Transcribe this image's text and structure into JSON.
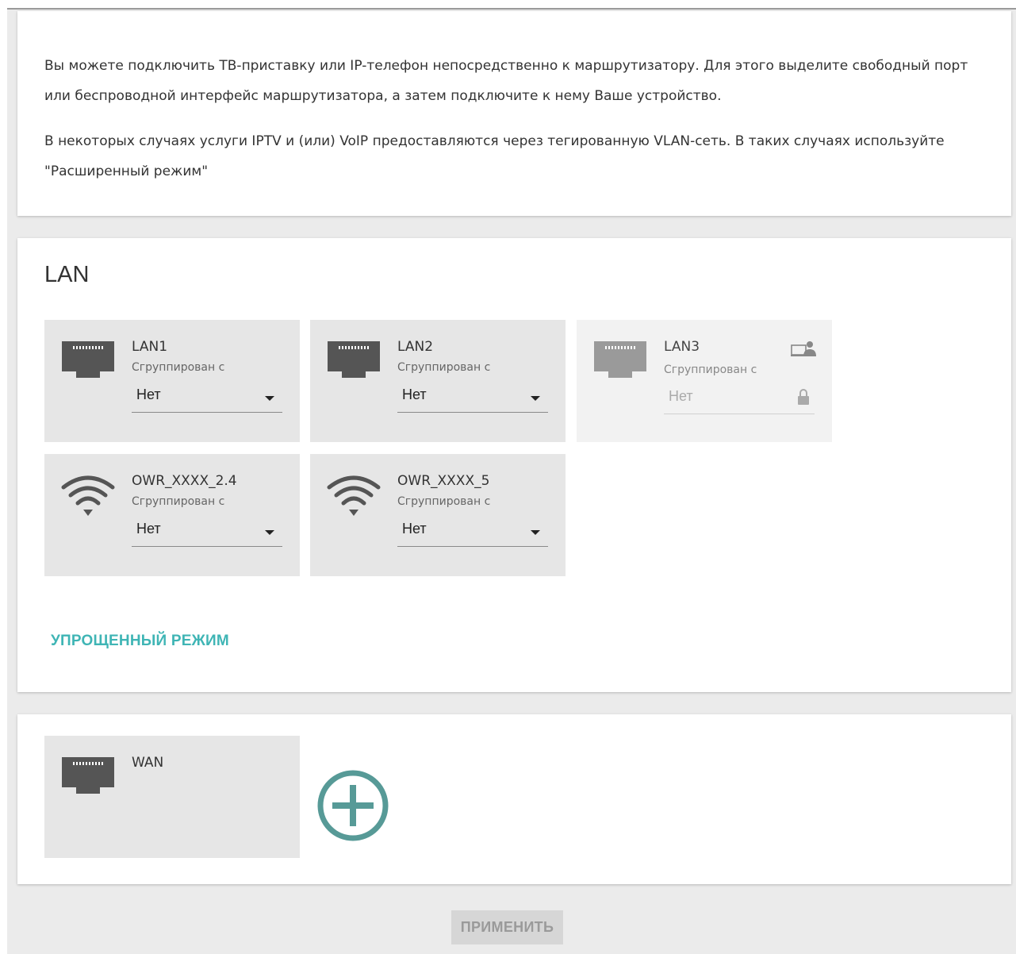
{
  "info": {
    "paragraph1": "Вы можете подключить ТВ-приставку или IP-телефон непосредственно к маршрутизатору. Для этого выделите свободный порт или беспроводной интерфейс маршрутизатора, а затем подключите к нему Ваше устройство.",
    "paragraph2": "В некоторых случаях услуги IPTV и (или) VoIP предоставляются через тегированную VLAN-сеть. В таких случаях используйте \"Расширенный режим\""
  },
  "lan": {
    "title": "LAN",
    "ports": [
      {
        "name": "LAN1",
        "grouped_label": "Сгруппирован с",
        "value": "Нет",
        "icon": "ethernet-port-icon",
        "disabled": false
      },
      {
        "name": "LAN2",
        "grouped_label": "Сгруппирован с",
        "value": "Нет",
        "icon": "ethernet-port-icon",
        "disabled": false
      },
      {
        "name": "LAN3",
        "grouped_label": "Сгруппирован с",
        "value": "Нет",
        "icon": "ethernet-port-icon",
        "disabled": true,
        "extra_icons": [
          "computer-user-icon",
          "lock-icon"
        ]
      },
      {
        "name": "OWR_XXXX_2.4",
        "grouped_label": "Сгруппирован с",
        "value": "Нет",
        "icon": "wifi-icon",
        "disabled": false
      },
      {
        "name": "OWR_XXXX_5",
        "grouped_label": "Сгруппирован с",
        "value": "Нет",
        "icon": "wifi-icon",
        "disabled": false
      }
    ],
    "simple_mode_label": "УПРОЩЕННЫЙ РЕЖИМ"
  },
  "wan": {
    "name": "WAN",
    "icon": "ethernet-port-icon",
    "add_icon": "add-circle-icon"
  },
  "apply_label": "ПРИМЕНИТЬ",
  "colors": {
    "accent": "#3fb5b5",
    "add_button": "#579a97",
    "port_tile": "#e6e6e6",
    "port_tile_disabled": "#f2f2f2",
    "page_bg": "#ebebeb"
  }
}
